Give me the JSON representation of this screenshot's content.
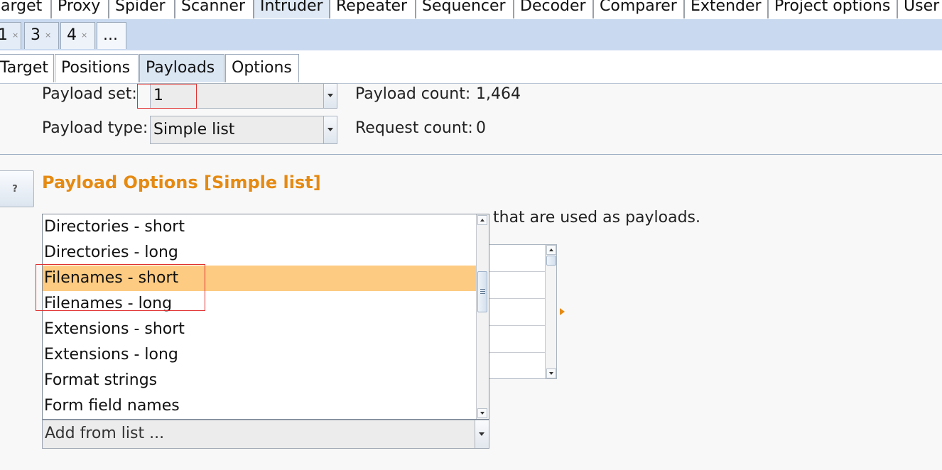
{
  "main_tabs": [
    "arget",
    "Proxy",
    "Spider",
    "Scanner",
    "Intruder",
    "Repeater",
    "Sequencer",
    "Decoder",
    "Comparer",
    "Extender",
    "Project options",
    "User"
  ],
  "active_main_tab": "Intruder",
  "instance_tabs": [
    {
      "label": "1",
      "close": "×"
    },
    {
      "label": "3",
      "close": "×"
    },
    {
      "label": "4",
      "close": "×"
    },
    {
      "label": "...",
      "close": ""
    }
  ],
  "sub_tabs": [
    "Target",
    "Positions",
    "Payloads",
    "Options"
  ],
  "active_sub_tab": "Payloads",
  "payload_sets": {
    "set_label": "Payload set:",
    "set_value": "1",
    "type_label": "Payload type:",
    "type_value": "Simple list",
    "count_label": "Payload count:",
    "count_value": "1,464",
    "request_label": "Request count:",
    "request_value": "0"
  },
  "help_button": "?",
  "payload_options": {
    "heading": "Payload Options [Simple list]",
    "description_visible": "that are used as payloads."
  },
  "dropdown": {
    "items": [
      "Directories - short",
      "Directories - long",
      "Filenames - short",
      "Filenames - long",
      "Extensions - short",
      "Extensions - long",
      "Format strings",
      "Form field names"
    ],
    "highlighted": "Filenames - short"
  },
  "add_from_list": {
    "label": "Add from list ..."
  },
  "colors": {
    "accent_orange": "#e58a12",
    "highlight": "#fdcb82",
    "annotation_red": "#e03030",
    "tab_strip": "#c9daf0"
  }
}
